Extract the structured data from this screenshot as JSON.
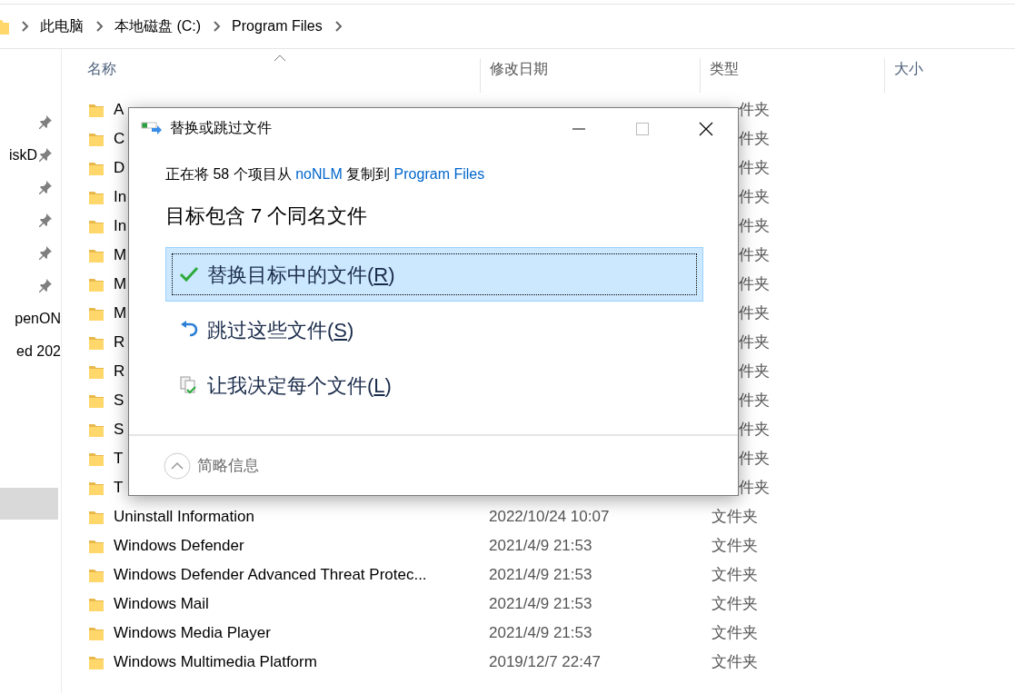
{
  "breadcrumb": {
    "items": [
      "此电脑",
      "本地磁盘 (C:)",
      "Program Files"
    ]
  },
  "sidebar": {
    "items": [
      {
        "pinned": true
      },
      {
        "label": "iskD",
        "pinned": true
      },
      {
        "pinned": true
      },
      {
        "pinned": true
      },
      {
        "pinned": true
      },
      {
        "pinned": true
      },
      {
        "label": "penON",
        "pinned": false
      },
      {
        "label": "ed 202",
        "pinned": false
      }
    ],
    "current": {
      "selected": true
    }
  },
  "columns": [
    {
      "label": "名称",
      "sorted": true
    },
    {
      "label": "修改日期",
      "sorted": false
    },
    {
      "label": "类型",
      "sorted": false
    },
    {
      "label": "大小",
      "sorted": false
    }
  ],
  "rows": [
    {
      "kind": "covered",
      "name": "A",
      "type": "件夹"
    },
    {
      "kind": "covered",
      "name": "C",
      "type": "件夹"
    },
    {
      "kind": "covered",
      "name": "D",
      "type": "件夹"
    },
    {
      "kind": "covered",
      "name": "In",
      "type": "件夹"
    },
    {
      "kind": "covered",
      "name": "In",
      "type": "件夹"
    },
    {
      "kind": "covered",
      "name": "M",
      "type": "件夹"
    },
    {
      "kind": "covered",
      "name": "M",
      "type": "件夹"
    },
    {
      "kind": "covered",
      "name": "M",
      "type": "件夹"
    },
    {
      "kind": "covered",
      "name": "R",
      "type": "件夹"
    },
    {
      "kind": "covered",
      "name": "R",
      "type": "件夹"
    },
    {
      "kind": "covered",
      "name": "S",
      "type": "件夹"
    },
    {
      "kind": "covered",
      "name": "S",
      "type": "件夹"
    },
    {
      "kind": "covered",
      "name": "T",
      "type": "件夹"
    },
    {
      "kind": "covered",
      "name": "T",
      "type": "件夹"
    },
    {
      "kind": "full",
      "name": "Uninstall Information",
      "date": "2022/10/24 10:07",
      "type": "文件夹"
    },
    {
      "kind": "full",
      "name": "Windows Defender",
      "date": "2021/4/9 21:53",
      "type": "文件夹"
    },
    {
      "kind": "full",
      "name": "Windows Defender Advanced Threat Protec...",
      "date": "2021/4/9 21:53",
      "type": "文件夹"
    },
    {
      "kind": "full",
      "name": "Windows Mail",
      "date": "2021/4/9 21:53",
      "type": "文件夹"
    },
    {
      "kind": "full",
      "name": "Windows Media Player",
      "date": "2021/4/9 21:53",
      "type": "文件夹"
    },
    {
      "kind": "full",
      "name": "Windows Multimedia Platform",
      "date": "2019/12/7 22:47",
      "type": "文件夹"
    }
  ],
  "dialog": {
    "title": "替换或跳过文件",
    "info": [
      {
        "text": "正在将 58 个项目从 ",
        "link": false
      },
      {
        "text": "noNLM",
        "link": true
      },
      {
        "text": " 复制到 ",
        "link": false
      },
      {
        "text": "Program Files",
        "link": true
      }
    ],
    "heading": "目标包含 7 个同名文件",
    "options": [
      {
        "kind": "replace",
        "before": "替换目标中的文件(",
        "key": "R",
        "after": ")",
        "selected": true
      },
      {
        "kind": "skip",
        "before": "跳过这些文件(",
        "key": "S",
        "after": ")",
        "selected": false
      },
      {
        "kind": "decide",
        "before": "让我决定每个文件(",
        "key": "L",
        "after": ")",
        "selected": false
      }
    ],
    "details": {
      "label": "简略信息",
      "expanded": true
    }
  }
}
